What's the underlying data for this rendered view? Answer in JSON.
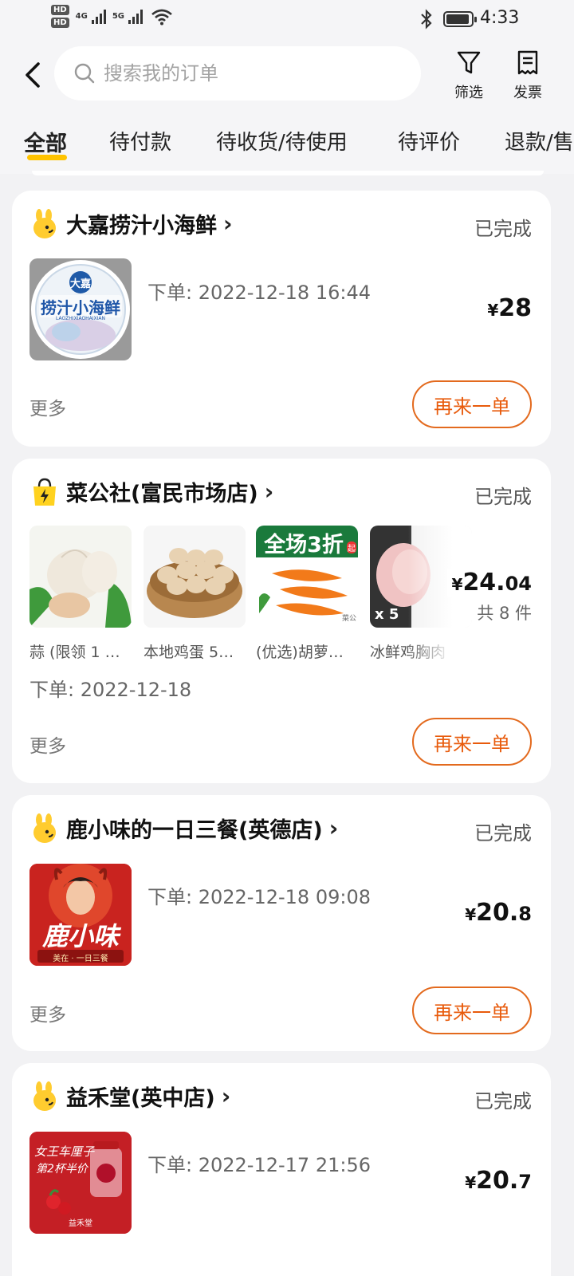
{
  "status_bar": {
    "time": "4:33",
    "hd1": "HD",
    "hd2": "HD",
    "net1": "4G",
    "net2": "5G"
  },
  "header": {
    "search_placeholder": "搜索我的订单",
    "filter_label": "筛选",
    "invoice_label": "发票"
  },
  "tabs": [
    "全部",
    "待付款",
    "待收货/待使用",
    "待评价",
    "退款/售后"
  ],
  "orders": [
    {
      "shop": "大嘉捞汁小海鲜",
      "status": "已完成",
      "order_time": "下单: 2022-12-18 16:44",
      "price_symbol": "¥",
      "price_int": "28",
      "price_dec": "",
      "more": "更多",
      "reorder": "再来一单",
      "logo_text_top": "大嘉",
      "logo_text_main": "捞汁小海鲜",
      "logo_text_sub": "LAOZHIXIAOHAIXIAN"
    },
    {
      "shop": "菜公社(富民市场店)",
      "status": "已完成",
      "order_time": "下单: 2022-12-18",
      "price_symbol": "¥",
      "price_int": "24.",
      "price_dec": "04",
      "count": "共 8 件",
      "more": "更多",
      "reorder": "再来一单",
      "products": [
        {
          "name": "蒜 (限领 1 …"
        },
        {
          "name": "本地鸡蛋 5…"
        },
        {
          "name": "(优选)胡萝…",
          "banner": "全场3折",
          "banner_small": "起",
          "tag": "菜公"
        },
        {
          "name": "冰鲜鸡胸肉",
          "qty": "x 5"
        }
      ]
    },
    {
      "shop": "鹿小味的一日三餐(英德店)",
      "status": "已完成",
      "order_time": "下单: 2022-12-18 09:08",
      "price_symbol": "¥",
      "price_int": "20.",
      "price_dec": "8",
      "more": "更多",
      "reorder": "再来一单",
      "logo_text_main": "鹿小味",
      "logo_text_sub": "美在 · 一日三餐"
    },
    {
      "shop": "益禾堂(英中店)",
      "status": "已完成",
      "order_time": "下单: 2022-12-17 21:56",
      "price_symbol": "¥",
      "price_int": "20.",
      "price_dec": "7",
      "logo_text_main": "女王车厘子",
      "logo_text_sub": "第2杯半价",
      "logo_brand": "益禾堂"
    }
  ]
}
